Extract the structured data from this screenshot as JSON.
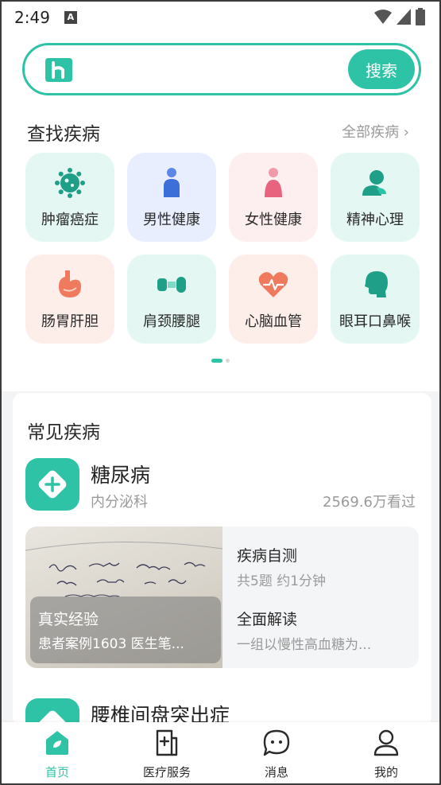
{
  "status_bar": {
    "time": "2:49",
    "notification_letter": "A"
  },
  "search": {
    "button_label": "搜索"
  },
  "find_section": {
    "title": "查找疾病",
    "see_all": "全部疾病 ›"
  },
  "categories": [
    {
      "label": "肿瘤癌症",
      "icon": "virus-icon",
      "bg": "#e4f7f2"
    },
    {
      "label": "男性健康",
      "icon": "male-person-icon",
      "bg": "#e8eefe"
    },
    {
      "label": "女性健康",
      "icon": "female-person-icon",
      "bg": "#fdeef0"
    },
    {
      "label": "精神心理",
      "icon": "mind-icon",
      "bg": "#e4f7f2"
    },
    {
      "label": "肠胃肝胆",
      "icon": "stomach-icon",
      "bg": "#fdeeea"
    },
    {
      "label": "肩颈腰腿",
      "icon": "bone-joint-icon",
      "bg": "#e4f7f2"
    },
    {
      "label": "心脑血管",
      "icon": "heart-pulse-icon",
      "bg": "#fdeeea"
    },
    {
      "label": "眼耳口鼻喉",
      "icon": "head-profile-icon",
      "bg": "#e4f7f2"
    }
  ],
  "common_section": {
    "title": "常见疾病"
  },
  "featured_disease": {
    "name": "糖尿病",
    "department": "内分泌科",
    "views": "2569.6万看过",
    "experience": {
      "title": "真实经验",
      "subtitle": "患者案例1603 医生笔..."
    },
    "self_test": {
      "title": "疾病自测",
      "subtitle": "共5题 约1分钟"
    },
    "overview": {
      "title": "全面解读",
      "subtitle": "一组以慢性高血糖为..."
    }
  },
  "next_disease": {
    "name": "腰椎间盘突出症"
  },
  "bottom_nav": [
    {
      "label": "首页",
      "active": true
    },
    {
      "label": "医疗服务",
      "active": false
    },
    {
      "label": "消息",
      "active": false
    },
    {
      "label": "我的",
      "active": false
    }
  ],
  "colors": {
    "accent": "#2ec3a6",
    "text": "#2a2a2a",
    "muted": "#9a9a9a",
    "coral": "#f07a5e",
    "blue": "#3d6fd8",
    "pink": "#e8647e"
  }
}
